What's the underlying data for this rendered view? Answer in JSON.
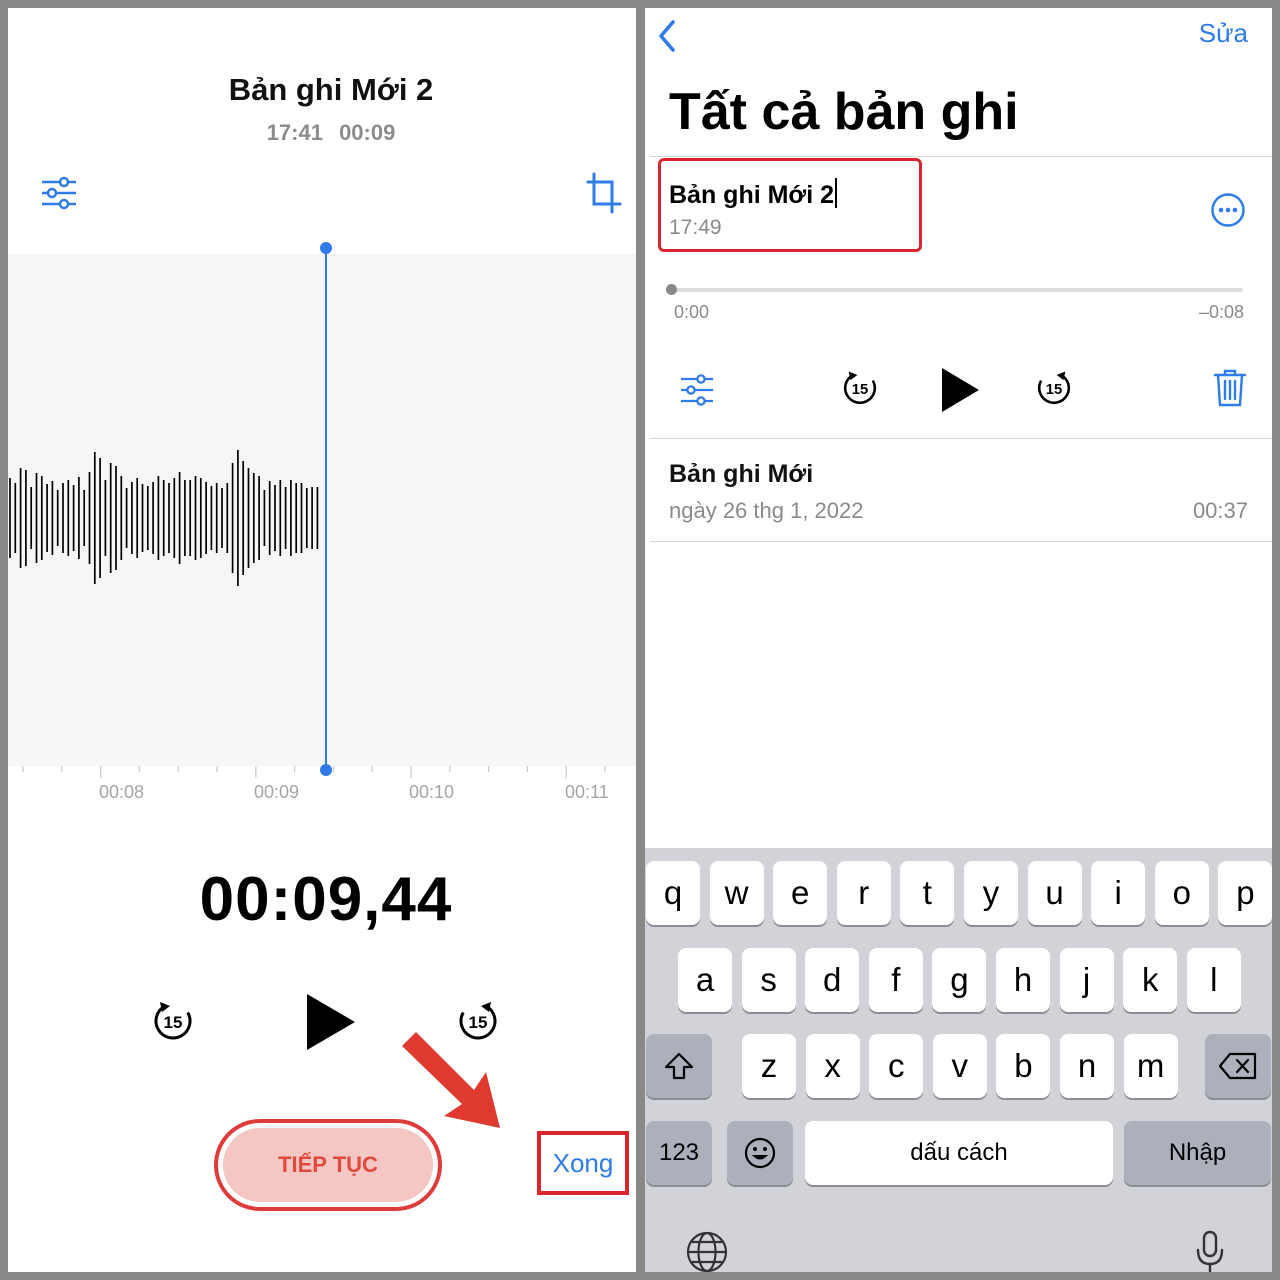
{
  "left": {
    "title": "Bản ghi Mới 2",
    "time": "17:41",
    "duration": "00:09",
    "timeline_labels": [
      "00:08",
      "00:09",
      "00:10",
      "00:11"
    ],
    "timer": "00:09,44",
    "skip_back_label": "15",
    "skip_fwd_label": "15",
    "continue_label": "TIẾP TỤC",
    "done_label": "Xong"
  },
  "right": {
    "edit_label": "Sửa",
    "title": "Tất cả bản ghi",
    "current": {
      "name": "Bản ghi Mới 2",
      "time": "17:49",
      "elapsed": "0:00",
      "remaining": "–0:08",
      "skip_back_label": "15",
      "skip_fwd_label": "15"
    },
    "recordings": [
      {
        "name": "Bản ghi Mới",
        "date": "ngày 26 thg 1, 2022",
        "duration": "00:37"
      }
    ]
  },
  "keyboard": {
    "row1": [
      "q",
      "w",
      "e",
      "r",
      "t",
      "y",
      "u",
      "i",
      "o",
      "p"
    ],
    "row2": [
      "a",
      "s",
      "d",
      "f",
      "g",
      "h",
      "j",
      "k",
      "l"
    ],
    "row3": [
      "z",
      "x",
      "c",
      "v",
      "b",
      "n",
      "m"
    ],
    "numbers_label": "123",
    "space_label": "dấu cách",
    "return_label": "Nhập"
  },
  "colors": {
    "accent": "#2f7bea",
    "highlight_red": "#d9262e",
    "continue_fill": "#f4c6c4",
    "continue_text": "#e0493d",
    "keyboard_bg": "#d1d3d9"
  }
}
